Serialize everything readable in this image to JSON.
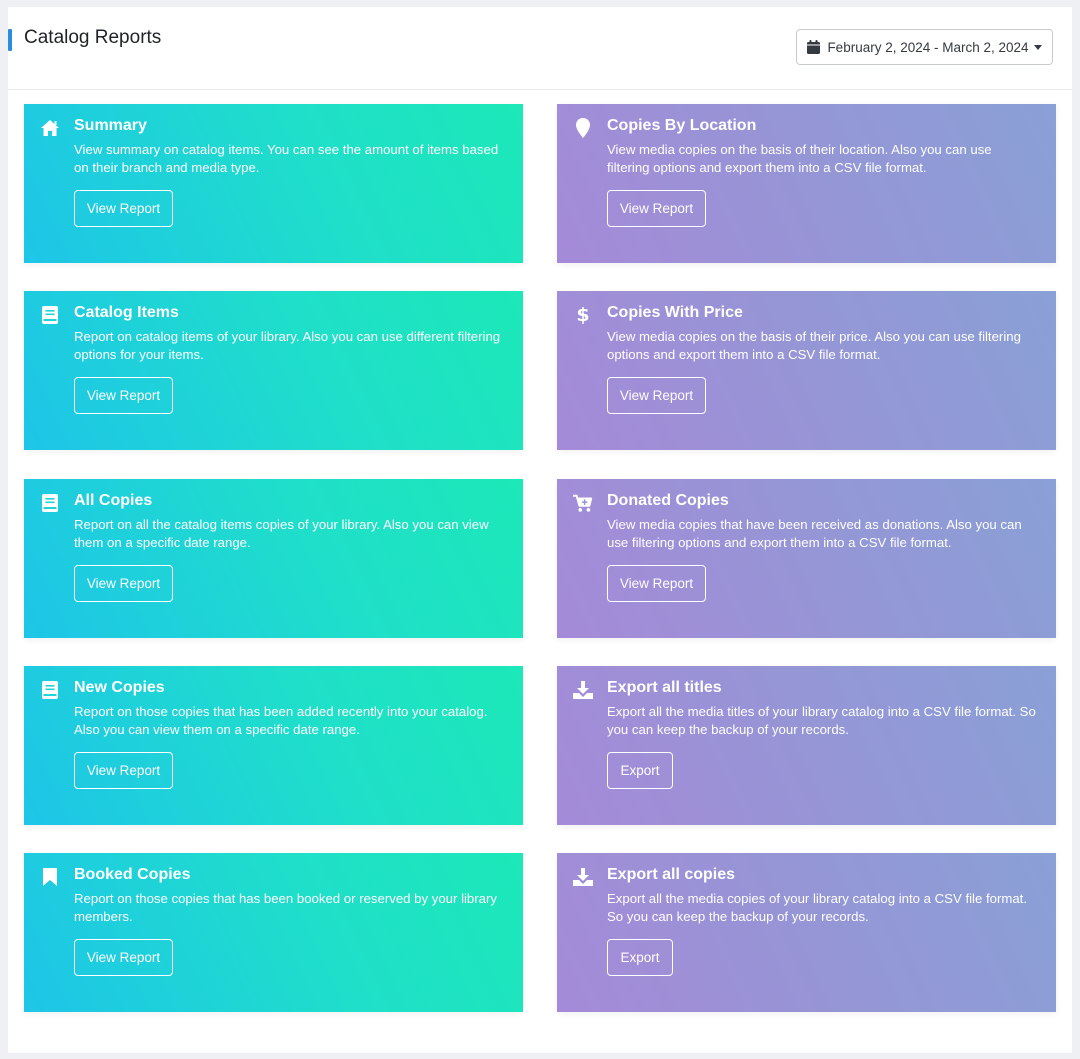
{
  "header": {
    "title": "Catalog Reports",
    "date_range": "February 2, 2024 - March 2, 2024"
  },
  "cards": [
    {
      "title": "Summary",
      "icon": "home-icon",
      "description": "View summary on catalog items. You can see the amount of items based on their branch and media type.",
      "button": "View Report"
    },
    {
      "title": "Copies By Location",
      "icon": "map-marker-icon",
      "description": "View media copies on the basis of their location. Also you can use filtering options and export them into a CSV file format.",
      "button": "View Report"
    },
    {
      "title": "Catalog Items",
      "icon": "book-icon",
      "description": "Report on catalog items of your library. Also you can use different filtering options for your items.",
      "button": "View Report"
    },
    {
      "title": "Copies With Price",
      "icon": "dollar-icon",
      "description": "View media copies on the basis of their price. Also you can use filtering options and export them into a CSV file format.",
      "button": "View Report"
    },
    {
      "title": "All Copies",
      "icon": "book-icon",
      "description": "Report on all the catalog items copies of your library. Also you can view them on a specific date range.",
      "button": "View Report"
    },
    {
      "title": "Donated Copies",
      "icon": "cart-icon",
      "description": "View media copies that have been received as donations. Also you can use filtering options and export them into a CSV file format.",
      "button": "View Report"
    },
    {
      "title": "New Copies",
      "icon": "book-icon",
      "description": "Report on those copies that has been added recently into your catalog. Also you can view them on a specific date range.",
      "button": "View Report"
    },
    {
      "title": "Export all titles",
      "icon": "download-icon",
      "description": "Export all the media titles of your library catalog into a CSV file format. So you can keep the backup of your records.",
      "button": "Export"
    },
    {
      "title": "Booked Copies",
      "icon": "bookmark-icon",
      "description": "Report on those copies that has been booked or reserved by your library members.",
      "button": "View Report"
    },
    {
      "title": "Export all copies",
      "icon": "download-icon",
      "description": "Export all the media copies of your library catalog into a CSV file format. So you can keep the backup of your records.",
      "button": "Export"
    }
  ],
  "colors": {
    "accent": "#2a8de0",
    "green_card_start": "#1ec5e8",
    "green_card_end": "#1ce8b8",
    "purple_card_start": "#a58ad8",
    "purple_card_end": "#8aa0d6"
  }
}
